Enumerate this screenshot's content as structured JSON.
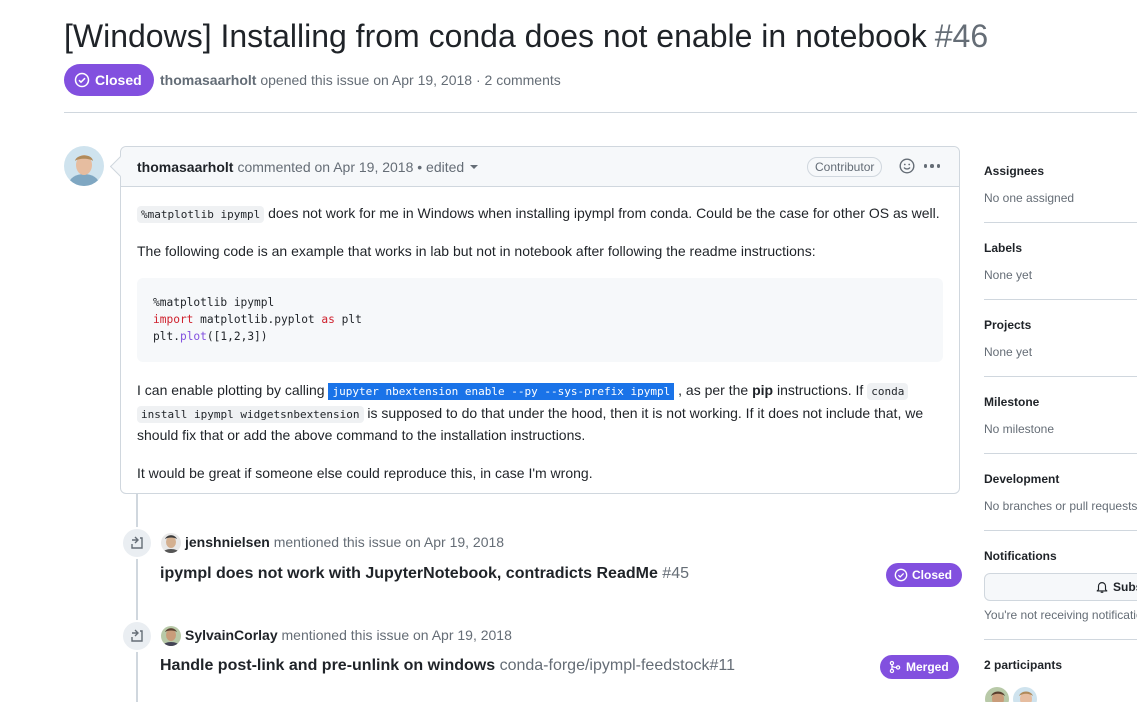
{
  "issue": {
    "title": "[Windows] Installing from conda does not enable in notebook",
    "number": "#46",
    "state": "Closed",
    "author": "thomasaarholt",
    "meta_text": "opened this issue on Apr 19, 2018 · 2 comments"
  },
  "comment": {
    "author": "thomasaarholt",
    "header_text": "commented on Apr 19, 2018 • edited",
    "role_badge": "Contributor",
    "p1_code": "%matplotlib ipympl",
    "p1_text": " does not work for me in Windows when installing ipympl from conda. Could be the case for other OS as well.",
    "p2_text": "The following code is an example that works in lab but not in notebook after following the readme instructions:",
    "code_line1": "%matplotlib ipympl",
    "code_line2_kw": "import",
    "code_line2_rest": " matplotlib.pyplot ",
    "code_line2_kw2": "as",
    "code_line2_end": " plt",
    "code_line3_a": "plt.",
    "code_line3_fn": "plot",
    "code_line3_b": "([1,2,3])",
    "p3_a": "I can enable plotting by calling ",
    "p3_code1": "jupyter nbextension enable --py --sys-prefix ipympl",
    "p3_b": " , as per the ",
    "p3_bold": "pip",
    "p3_c": " instructions. If ",
    "p3_code2a": "conda",
    "p3_code2b": "install ipympl widgetsnbextension",
    "p3_d": " is supposed to do that under the hood, then it is not working. If it does not include that, we should fix that or add the above command to the installation instructions.",
    "p4_text": "It would be great if someone else could reproduce this, in case I'm wrong."
  },
  "timeline": [
    {
      "user": "jenshnielsen",
      "action": "mentioned this issue on Apr 19, 2018",
      "title": "ipympl does not work with JupyterNotebook, contradicts ReadMe",
      "ref": "#45",
      "badge": "Closed"
    },
    {
      "user": "SylvainCorlay",
      "action": "mentioned this issue on Apr 19, 2018",
      "title": "Handle post-link and pre-unlink on windows",
      "ref": "conda-forge/ipympl-feedstock#11",
      "badge": "Merged"
    }
  ],
  "sidebar": {
    "assignees_h": "Assignees",
    "assignees_v": "No one assigned",
    "labels_h": "Labels",
    "labels_v": "None yet",
    "projects_h": "Projects",
    "projects_v": "None yet",
    "milestone_h": "Milestone",
    "milestone_v": "No milestone",
    "development_h": "Development",
    "development_v": "No branches or pull requests",
    "notifications_h": "Notifications",
    "subscribe_label": "Subscribe",
    "notifications_note": "You're not receiving notifications from this thread.",
    "participants_h": "2 participants"
  },
  "colors": {
    "closed_purple": "#8250df",
    "selection_blue": "#1a73e8"
  }
}
